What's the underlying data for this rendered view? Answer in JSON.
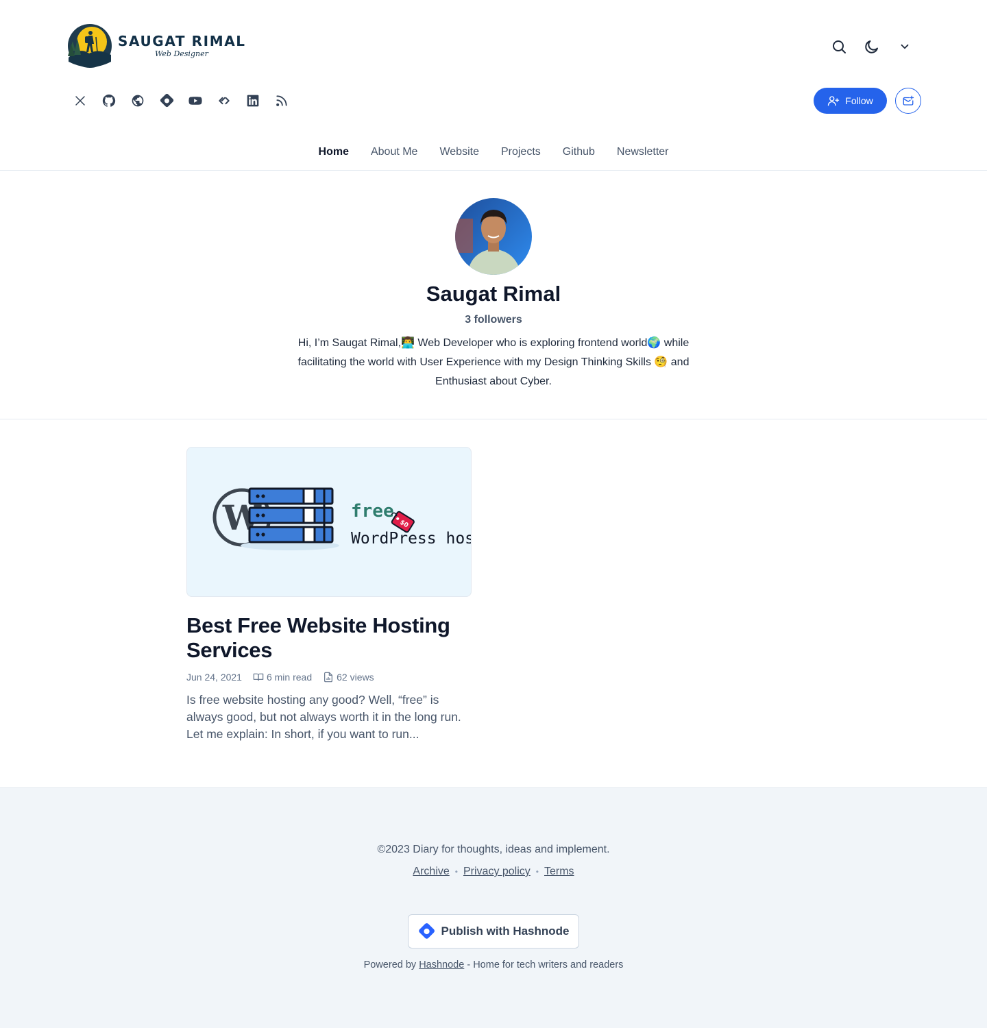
{
  "blog": {
    "logo_title": "SAUGAT RIMAL",
    "logo_subtitle": "Web Designer"
  },
  "colors": {
    "accent": "#2563eb",
    "text": "#0f172a",
    "muted": "#475569",
    "footer_bg": "#f1f5f9"
  },
  "header": {
    "top_icons": [
      "search-icon",
      "moon-icon",
      "chevron-down-icon"
    ],
    "social_icons": [
      "x-twitter-icon",
      "github-icon",
      "globe-icon",
      "hashnode-icon",
      "youtube-icon",
      "dailydev-icon",
      "linkedin-icon",
      "rss-icon"
    ],
    "follow_label": "Follow",
    "newsletter_icon": "mail-plus-icon"
  },
  "nav": {
    "items": [
      "Home",
      "About Me",
      "Website",
      "Projects",
      "Github",
      "Newsletter"
    ],
    "active": "Home"
  },
  "profile": {
    "name": "Saugat Rimal",
    "followers": "3 followers",
    "bio": "Hi, I’m Saugat Rimal,👨‍💻 Web Developer who is exploring frontend world🌍 while facilitating the world with User Experience with my Design Thinking Skills 🧐 and Enthusiast about Cyber."
  },
  "post": {
    "cover_word_free": "free",
    "cover_word_hosting": "WordPress hos",
    "cover_tag": "$0",
    "title": "Best Free Website Hosting Services",
    "date": "Jun 24, 2021",
    "read_time": "6 min read",
    "views": "62 views",
    "excerpt": "Is free website hosting any good? Well, “free” is always good, but not always worth it in the long run. Let me explain: In short, if you want to run..."
  },
  "footer": {
    "copyright": "©2023 Diary for thoughts, ideas and implement.",
    "links": [
      "Archive",
      "Privacy policy",
      "Terms"
    ],
    "publish_label": "Publish with Hashnode",
    "powered_prefix": "Powered by",
    "powered_link": "Hashnode",
    "powered_suffix": "- Home for tech writers and readers"
  }
}
